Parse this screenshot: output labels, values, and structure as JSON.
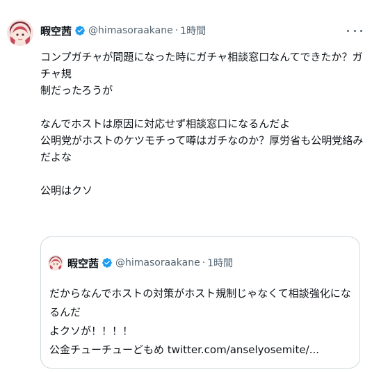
{
  "tweet": {
    "author_name": "暇空茜",
    "handle": "@himasoraakane",
    "separator": "·",
    "time": "1時間",
    "body_lines": [
      "コンプガチャが問題になった時にガチャ相談窓口なんてできたか？ガチャ規",
      "制だったろうが",
      "",
      "なんでホストは原因に対応せず相談窓口になるんだよ",
      "公明党がホストのケツモチって噂はガチなのか？厚労省も公明党絡みだよな",
      "",
      "公明はクソ"
    ]
  },
  "quote": {
    "author_name": "暇空茜",
    "handle": "@himasoraakane",
    "separator": "·",
    "time": "1時間",
    "body_lines": [
      "だからなんでホストの対策がホスト規制じゃなくて相談強化になるんだ",
      "よクソが！！！！"
    ],
    "last_line_text": "公金チューチューどもめ ",
    "link": "twitter.com/anselyosemite/..."
  },
  "colors": {
    "text": "#0f1419",
    "secondary": "#536471",
    "verified": "#1d9bf0",
    "border": "#cfd9de"
  },
  "icons": [
    "avatar",
    "verified-badge-icon",
    "more-options-icon"
  ]
}
